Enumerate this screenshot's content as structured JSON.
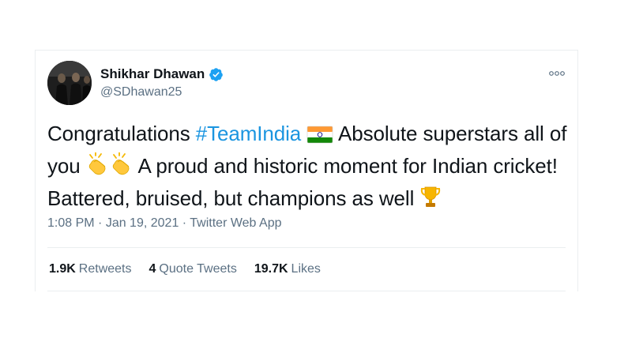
{
  "author": {
    "display_name": "Shikhar Dhawan",
    "handle": "@SDhawan25",
    "verified": true
  },
  "tweet": {
    "text_1": "Congratulations ",
    "hashtag": "#TeamIndia",
    "text_2": " Absolute superstars all of you ",
    "text_3": " A proud and historic moment for Indian cricket! Battered, bruised, but champions as well ",
    "emojis": [
      "india-flag-icon",
      "clapping-hands-icon",
      "clapping-hands-icon",
      "trophy-icon"
    ]
  },
  "meta": {
    "time": "1:08 PM",
    "separator_1": " · ",
    "date": "Jan 19, 2021",
    "separator_2": " · ",
    "source": "Twitter Web App"
  },
  "stats": [
    {
      "value": "1.9K",
      "label": "Retweets"
    },
    {
      "value": "4",
      "label": "Quote Tweets"
    },
    {
      "value": "19.7K",
      "label": "Likes"
    }
  ],
  "colors": {
    "link": "#1b95e0",
    "verified": "#1da1f2",
    "secondary_text": "#5b7083",
    "border": "#ebeef0"
  }
}
